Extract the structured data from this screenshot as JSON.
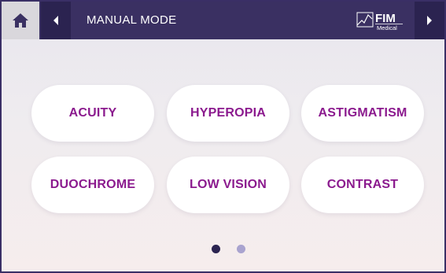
{
  "header": {
    "title": "MANUAL MODE",
    "home_icon": "home-icon",
    "back_icon": "caret-left-icon",
    "forward_icon": "caret-right-icon",
    "logo_text": "FIM",
    "logo_subtext": "Medical"
  },
  "modes": [
    {
      "label": "ACUITY"
    },
    {
      "label": "HYPEROPIA"
    },
    {
      "label": "ASTIGMATISM"
    },
    {
      "label": "DUOCHROME"
    },
    {
      "label": "LOW VISION"
    },
    {
      "label": "CONTRAST"
    }
  ],
  "pager": {
    "total_pages": 2,
    "current_page": 1
  },
  "colors": {
    "header_bg": "#3a3062",
    "nav_button_bg": "#2b2350",
    "home_button_bg": "#d9d7dc",
    "button_text": "#8b1a8e",
    "dot_active": "#2b2350",
    "dot_inactive": "#a9a3cf"
  }
}
